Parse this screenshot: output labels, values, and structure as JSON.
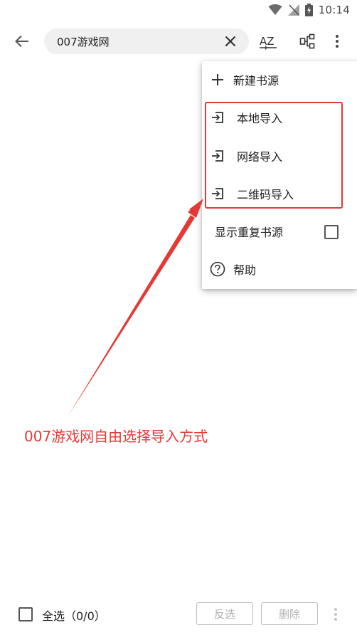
{
  "status_bar": {
    "time": "10:14"
  },
  "toolbar": {
    "search_value": "007游戏网",
    "sort_label": "AZ"
  },
  "menu": {
    "items": [
      {
        "label": "新建书源",
        "icon": "plus-icon"
      },
      {
        "label": "本地导入",
        "icon": "import-icon"
      },
      {
        "label": "网络导入",
        "icon": "import-icon"
      },
      {
        "label": "二维码导入",
        "icon": "import-icon"
      },
      {
        "label": "显示重复书源",
        "icon": "checkbox"
      },
      {
        "label": "帮助",
        "icon": "help-circle-icon"
      }
    ]
  },
  "annotation": {
    "text": "007游戏网自由选择导入方式",
    "color": "#e53935"
  },
  "bottom_bar": {
    "select_all_label": "全选（0/0）",
    "invert_label": "反选",
    "delete_label": "删除"
  }
}
